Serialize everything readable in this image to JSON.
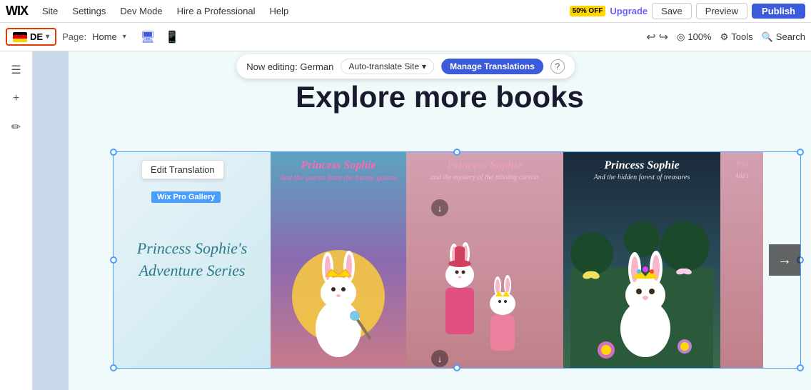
{
  "topbar": {
    "logo": "WIX",
    "nav": [
      "Site",
      "Settings",
      "Dev Mode",
      "Hire a Professional",
      "Help"
    ],
    "sale_badge": "50% OFF",
    "upgrade_label": "Upgrade",
    "save_label": "Save",
    "preview_label": "Preview",
    "publish_label": "Publish"
  },
  "toolbar2": {
    "lang_code": "DE",
    "page_prefix": "Page:",
    "page_name": "Home",
    "zoom_level": "100%",
    "tools_label": "Tools",
    "search_label": "Search"
  },
  "translation_bar": {
    "editing_text": "Now editing: German",
    "auto_translate_label": "Auto-translate Site",
    "manage_label": "Manage Translations",
    "help_symbol": "?"
  },
  "canvas": {
    "heading": "Explore more books",
    "edit_translation_label": "Edit Translation",
    "wix_gallery_label": "Wix Pro Gallery",
    "gallery_arrow": "→"
  },
  "books": [
    {
      "title_line1": "Princess Sophie's",
      "title_line2": "Adventure Series",
      "type": "series"
    },
    {
      "title": "Princess Sophie",
      "subtitle": "And the guests from the bunny galaxy",
      "type": "cover"
    },
    {
      "title": "Princess Sophie",
      "subtitle": "and the mystery of the missing carrots",
      "type": "cover"
    },
    {
      "title": "Princess Sophie",
      "subtitle": "And the hidden forest of treasures",
      "type": "cover"
    },
    {
      "title": "Pri",
      "subtitle": "And t",
      "type": "partial"
    }
  ],
  "icons": {
    "undo": "↩",
    "redo": "↪",
    "desktop": "🖥",
    "mobile": "📱",
    "tools": "⚙",
    "search": "🔍",
    "pages": "☰",
    "add": "+",
    "edit": "✏"
  }
}
